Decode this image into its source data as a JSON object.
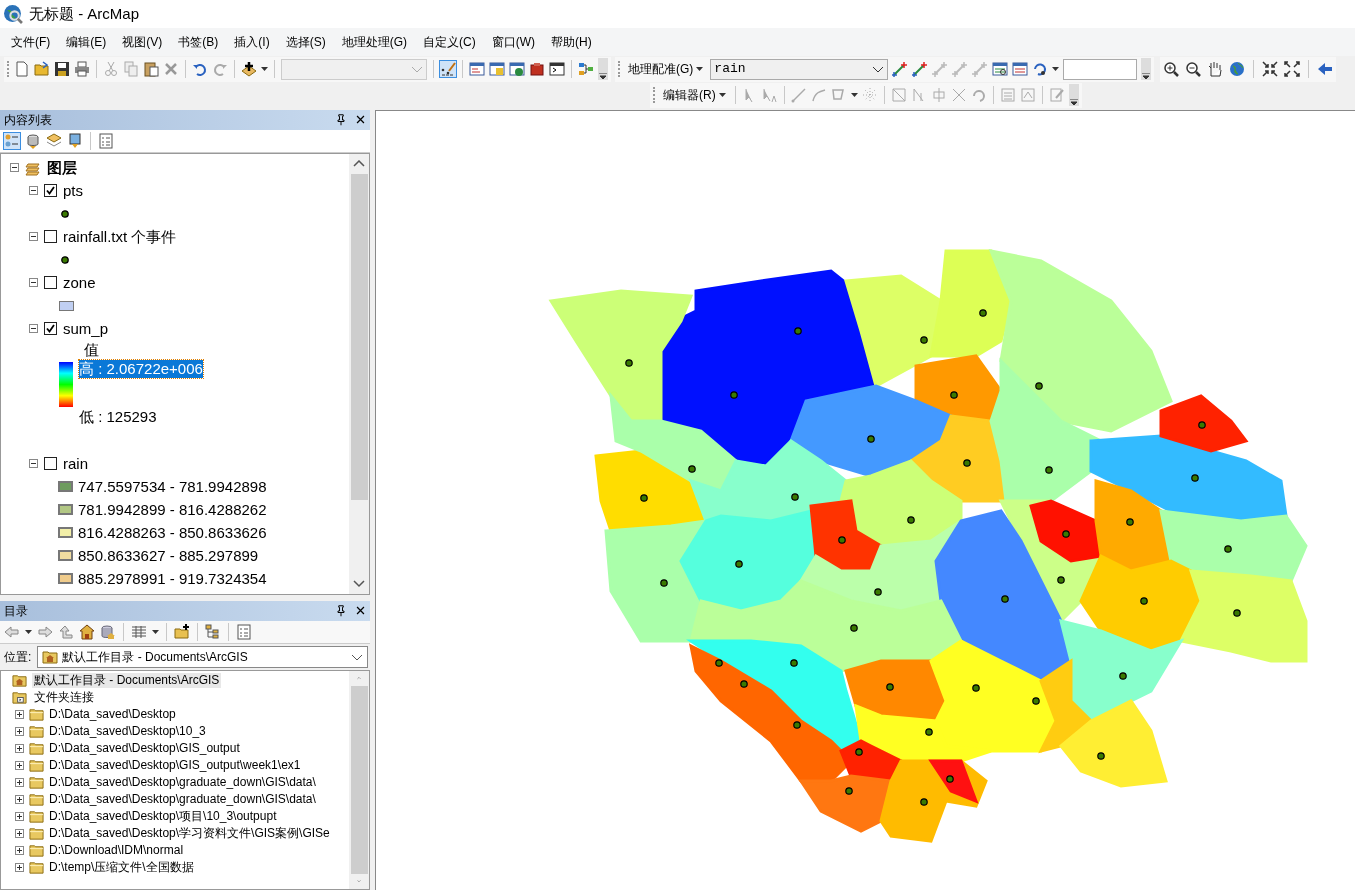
{
  "window": {
    "title": "无标题 - ArcMap"
  },
  "menu": [
    "文件(F)",
    "编辑(E)",
    "视图(V)",
    "书签(B)",
    "插入(I)",
    "选择(S)",
    "地理处理(G)",
    "自定义(C)",
    "窗口(W)",
    "帮助(H)"
  ],
  "toolbars": {
    "georeferencing": {
      "label": "地理配准(G)",
      "layer": "rain"
    },
    "editor": {
      "label": "编辑器(R)"
    }
  },
  "table_of_contents": {
    "title": "内容列表",
    "root": "图层",
    "expanded": true,
    "layers": [
      {
        "name": "pts",
        "checked": true,
        "expanded": true,
        "kind": "point"
      },
      {
        "name": "rainfall.txt 个事件",
        "checked": false,
        "expanded": true,
        "kind": "point"
      },
      {
        "name": "zone",
        "checked": false,
        "expanded": true,
        "kind": "fill",
        "color": "#c0cff2"
      },
      {
        "name": "sum_p",
        "checked": true,
        "expanded": true,
        "kind": "ramp",
        "field": "值",
        "high": "高 : 2.06722e+006",
        "high_selected": true,
        "low": "低 : 125293"
      },
      {
        "name": "rain",
        "checked": false,
        "expanded": true,
        "kind": "classes",
        "classes": [
          {
            "label": "747.5597534 - 781.9942898",
            "color": "#6e9c5e"
          },
          {
            "label": "781.9942899 - 816.4288262",
            "color": "#b2c784"
          },
          {
            "label": "816.4288263 - 850.8633626",
            "color": "#f2efa8"
          },
          {
            "label": "850.8633627 - 885.297899",
            "color": "#f2dea0"
          },
          {
            "label": "885.2978991 - 919.7324354",
            "color": "#f0cc8c"
          }
        ]
      }
    ]
  },
  "catalog": {
    "title": "目录",
    "location_label": "位置:",
    "location": "默认工作目录 - Documents\\ArcGIS",
    "items": [
      {
        "label": "默认工作目录 - Documents\\ArcGIS",
        "kind": "home",
        "selected": true
      },
      {
        "label": "文件夹连接",
        "kind": "connections",
        "selected": false,
        "children": [
          {
            "label": "D:\\Data_saved\\Desktop",
            "expanded": false
          },
          {
            "label": "D:\\Data_saved\\Desktop\\10_3",
            "expanded": false
          },
          {
            "label": "D:\\Data_saved\\Desktop\\GIS_output",
            "expanded": false
          },
          {
            "label": "D:\\Data_saved\\Desktop\\GIS_output\\week1\\ex1",
            "expanded": false
          },
          {
            "label": "D:\\Data_saved\\Desktop\\graduate_down\\GIS\\data\\",
            "expanded": false
          },
          {
            "label": "D:\\Data_saved\\Desktop\\graduate_down\\GIS\\data\\",
            "expanded": false
          },
          {
            "label": "D:\\Data_saved\\Desktop\\项目\\10_3\\outpupt",
            "expanded": false
          },
          {
            "label": "D:\\Data_saved\\Desktop\\学习资料文件\\GIS案例\\GISe",
            "expanded": false
          },
          {
            "label": "D:\\Download\\IDM\\normal",
            "expanded": false
          },
          {
            "label": "D:\\temp\\压缩文件\\全国数据",
            "expanded": false
          }
        ]
      }
    ]
  }
}
